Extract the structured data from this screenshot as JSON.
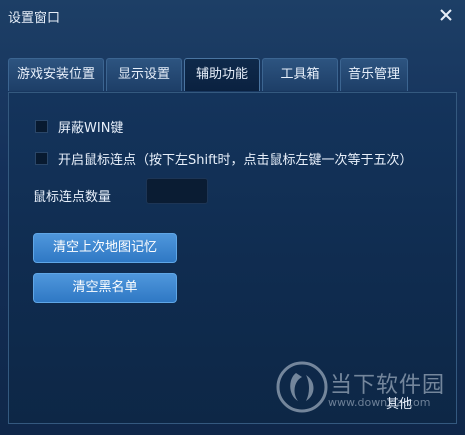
{
  "window": {
    "title": "设置窗口",
    "close_glyph": "✕"
  },
  "tabs": [
    {
      "label": "游戏安装位置",
      "active": false
    },
    {
      "label": "显示设置",
      "active": false
    },
    {
      "label": "辅助功能",
      "active": true
    },
    {
      "label": "工具箱",
      "active": false
    },
    {
      "label": "音乐管理",
      "active": false
    }
  ],
  "options": {
    "block_win_key": {
      "label": "屏蔽WIN键",
      "checked": false
    },
    "mouse_burst": {
      "label": "开启鼠标连点（按下左Shift时，点击鼠标左键一次等于五次）",
      "checked": false
    }
  },
  "burst_count": {
    "label": "鼠标连点数量",
    "value": ""
  },
  "buttons": {
    "clear_map_memory": "清空上次地图记忆",
    "clear_blacklist": "清空黑名单"
  },
  "watermark": {
    "text": "当下软件园",
    "url": "www.downxia.com"
  },
  "footer": {
    "other_label": "其他"
  },
  "colors": {
    "accent": "#3a86d4",
    "background": "#14305a"
  }
}
